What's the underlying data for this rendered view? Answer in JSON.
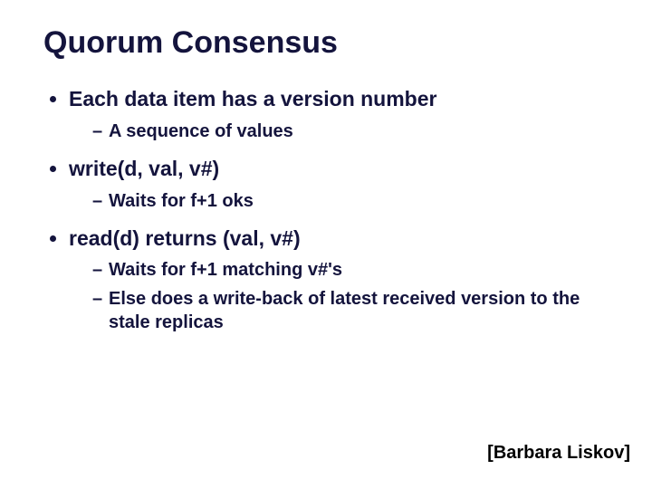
{
  "title": "Quorum Consensus",
  "bullets": [
    {
      "text": "Each data item has a version number",
      "sub": [
        "A sequence of values"
      ]
    },
    {
      "text": "write(d, val, v#)",
      "sub": [
        "Waits for f+1 oks"
      ]
    },
    {
      "text": "read(d) returns (val, v#)",
      "sub": [
        "Waits for f+1 matching v#'s",
        "Else does a write-back of latest received version to the stale replicas"
      ]
    }
  ],
  "attribution": "[Barbara Liskov]"
}
